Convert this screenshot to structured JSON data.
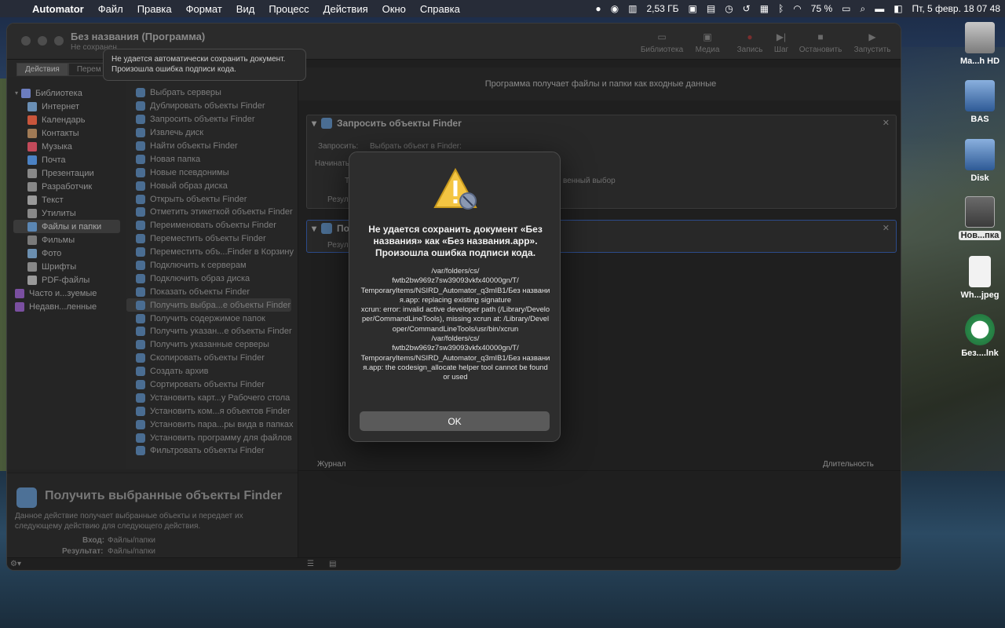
{
  "menubar": {
    "app_name": "Automator",
    "menus": [
      "Файл",
      "Правка",
      "Формат",
      "Вид",
      "Процесс",
      "Действия",
      "Окно",
      "Справка"
    ],
    "memory": "2,53 ГБ",
    "battery": "75 %",
    "clock": "Пт, 5 февр.  18 07 48"
  },
  "window": {
    "title": "Без названия (Программа)",
    "subtitle": "Не сохранен",
    "toolbar": {
      "library": "Библиотека",
      "media": "Медиа",
      "record": "Запись",
      "step": "Шаг",
      "stop": "Остановить",
      "run": "Запустить"
    },
    "segments": [
      "Действия",
      "Перем"
    ]
  },
  "tooltip": {
    "line1": "Не удается автоматически сохранить документ.",
    "line2": "Произошла ошибка подписи кода."
  },
  "sidebar": {
    "items": [
      {
        "label": "Библиотека",
        "color": "#6c7dbf"
      },
      {
        "label": "Интернет",
        "color": "#6a8fb5"
      },
      {
        "label": "Календарь",
        "color": "#c9553b"
      },
      {
        "label": "Контакты",
        "color": "#a07a55"
      },
      {
        "label": "Музыка",
        "color": "#c24a5a"
      },
      {
        "label": "Почта",
        "color": "#4b82c4"
      },
      {
        "label": "Презентации",
        "color": "#888888"
      },
      {
        "label": "Разработчик",
        "color": "#888888"
      },
      {
        "label": "Текст",
        "color": "#999999"
      },
      {
        "label": "Утилиты",
        "color": "#888888"
      },
      {
        "label": "Файлы и папки",
        "color": "#5b86b3"
      },
      {
        "label": "Фильмы",
        "color": "#7a7a7a"
      },
      {
        "label": "Фото",
        "color": "#6b8fb0"
      },
      {
        "label": "Шрифты",
        "color": "#888888"
      },
      {
        "label": "PDF-файлы",
        "color": "#999999"
      },
      {
        "label": "Часто и...зуемые",
        "color": "#7a4fa0"
      },
      {
        "label": "Недавн...ленные",
        "color": "#7a4fa0"
      }
    ]
  },
  "actions": {
    "items": [
      "Выбрать серверы",
      "Дублировать объекты Finder",
      "Запросить объекты Finder",
      "Извлечь диск",
      "Найти объекты Finder",
      "Новая папка",
      "Новые псевдонимы",
      "Новый образ диска",
      "Открыть объекты Finder",
      "Отметить этикеткой объекты Finder",
      "Переименовать объекты Finder",
      "Переместить объекты Finder",
      "Переместить объ...Finder в Корзину",
      "Подключить к серверам",
      "Подключить образ диска",
      "Показать объекты Finder",
      "Получить выбра...е объекты Finder",
      "Получить содержимое папок",
      "Получить указан...е объекты Finder",
      "Получить указанные серверы",
      "Скопировать объекты Finder",
      "Создать архив",
      "Сортировать объекты Finder",
      "Установить карт...у Рабочего стола",
      "Установить ком...я объектов Finder",
      "Установить пара...ры вида в папках",
      "Установить программу для файлов",
      "Фильтровать объекты Finder"
    ],
    "selected_index": 16
  },
  "description": {
    "title": "Получить выбранные объекты Finder",
    "text": "Данное действие получает выбранные объекты и передает их следующему действию для следующего действия.",
    "input_label": "Вход:",
    "input_value": "Файлы/папки",
    "result_label": "Результат:",
    "result_value": "Файлы/папки"
  },
  "workflow": {
    "header": "Программа получает файлы и папки как входные данные",
    "card1": {
      "title": "Запросить объекты Finder",
      "ask_label": "Запросить:",
      "ask_value": "Выбрать объект в Finder:",
      "start_label": "Начинать",
      "fragment": "венный выбор",
      "t_label": "Т",
      "results_label": "Резуль"
    },
    "card2": {
      "title": "По",
      "results_label": "Резуль"
    },
    "journal": "Журнал",
    "duration": "Длительность"
  },
  "dialog": {
    "heading": "Не удается сохранить документ «Без названия» как «Без названия.app». Произошла ошибка подписи кода.",
    "body": "/var/folders/cs/\nfwtb2bw969z7sw39093vkfx40000gn/T/\nTemporaryItems/NSIRD_Automator_q3mIB1/Без названия.app: replacing existing signature\nxcrun: error: invalid active developer path (/Library/Developer/CommandLineTools), missing xcrun at: /Library/Developer/CommandLineTools/usr/bin/xcrun\n/var/folders/cs/\nfwtb2bw969z7sw39093vkfx40000gn/T/\nTemporaryItems/NSIRD_Automator_q3mIB1/Без названия.app: the codesign_allocate helper tool cannot be found or used",
    "ok": "OK"
  },
  "desktop": {
    "icons": [
      {
        "label": "Ma...h HD",
        "icon": "hard-drive-icon"
      },
      {
        "label": "BAS",
        "icon": "network-share-icon"
      },
      {
        "label": "Disk",
        "icon": "network-share-icon"
      },
      {
        "label": "Нов...пка",
        "icon": "folder-icon"
      },
      {
        "label": "Wh...jpeg",
        "icon": "document-icon"
      },
      {
        "label": "Без....lnk",
        "icon": "shortcut-icon"
      }
    ]
  }
}
